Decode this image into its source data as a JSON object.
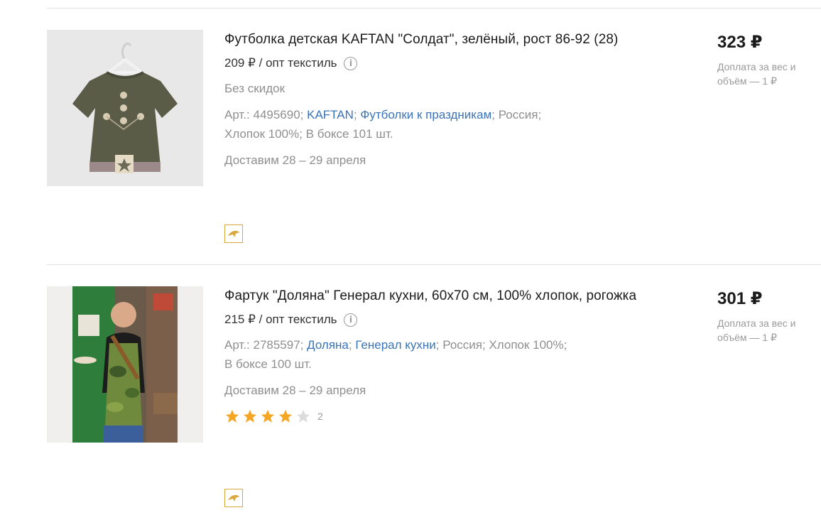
{
  "products": [
    {
      "title": "Футболка детская KAFTAN \"Солдат\", зелёный, рост 86-92 (28)",
      "wholesale_price": "209 ₽ / опт текстиль",
      "discount_text": "Без скидок",
      "art_prefix": "Арт.: 4495690; ",
      "brand_link": "KAFTAN",
      "sep1": "; ",
      "collection_link": "Футболки к праздникам",
      "meta_tail_line1": "; Россия;",
      "meta_line2": "Хлопок 100%; В боксе 101 шт.",
      "delivery": "Доставим 28 – 29 апреля",
      "price": "323 ₽",
      "surcharge": "Доплата за вес и объём — 1 ₽",
      "promo_icon": "dolphin-icon",
      "image_icon": "tshirt-image"
    },
    {
      "title": "Фартук \"Доляна\" Генерал кухни, 60х70 см, 100% хлопок, рогожка",
      "wholesale_price": "215 ₽ / опт текстиль",
      "art_prefix": "Арт.: 2785597; ",
      "brand_link": "Доляна",
      "sep1": "; ",
      "collection_link": "Генерал кухни",
      "meta_tail_line1": "; Россия; Хлопок 100%;",
      "meta_line2": "В боксе 100 шт.",
      "delivery": "Доставим 28 – 29 апреля",
      "rating_value": 4,
      "rating_max": 5,
      "rating_count": "2",
      "price": "301 ₽",
      "surcharge": "Доплата за вес и объём — 1 ₽",
      "promo_icon": "dolphin-icon",
      "image_icon": "apron-photo"
    }
  ],
  "colors": {
    "link": "#3b74b6",
    "muted": "#8f8f8f",
    "star_filled": "#f5a623",
    "star_empty": "#dcdcdc",
    "promo_border": "#d9a73b"
  }
}
